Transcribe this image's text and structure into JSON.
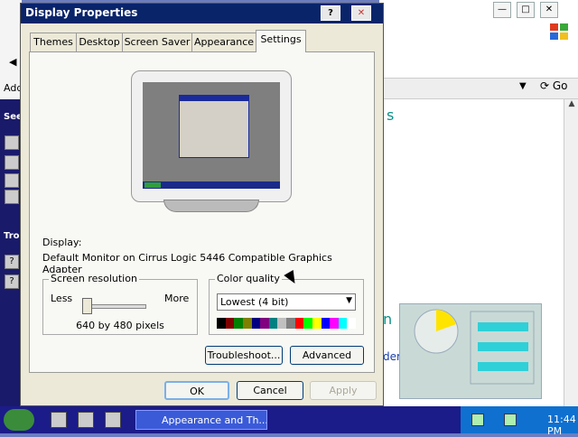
{
  "dialog": {
    "title": "Display Properties",
    "help_btn": "?",
    "close_btn": "✕",
    "tabs": [
      "Themes",
      "Desktop",
      "Screen Saver",
      "Appearance",
      "Settings"
    ],
    "selected_tab": "Settings",
    "display_label": "Display:",
    "display_value": "Default Monitor on Cirrus Logic 5446 Compatible Graphics Adapter",
    "screen_resolution": {
      "legend": "Screen resolution",
      "less": "Less",
      "more": "More",
      "value_text": "640 by 480 pixels",
      "slider_level": 0.0
    },
    "color_quality": {
      "legend": "Color quality",
      "selected": "Lowest (4 bit)",
      "palette": [
        "#000000",
        "#800000",
        "#008000",
        "#808000",
        "#000080",
        "#800080",
        "#008080",
        "#c0c0c0",
        "#808080",
        "#ff0000",
        "#00ff00",
        "#ffff00",
        "#0000ff",
        "#ff00ff",
        "#00ffff",
        "#ffffff"
      ]
    },
    "buttons": {
      "troubleshoot": "Troubleshoot...",
      "advanced": "Advanced",
      "ok": "OK",
      "cancel": "Cancel",
      "apply": "Apply"
    }
  },
  "background_window": {
    "go_label": "Go",
    "teal_char_top": "s",
    "teal_char_bottom": "n",
    "link_text": "der Options",
    "min": "—",
    "max": "□",
    "close": "✕"
  },
  "left_strip": {
    "address": "Add",
    "see": "See",
    "tro": "Tro"
  },
  "taskbar": {
    "task_label": "Appearance and Th...",
    "clock": "11:44 PM"
  },
  "colors": {
    "title_bar": "#0a246a",
    "taskbar": "#1b1b8a",
    "tray": "#0f70d0"
  }
}
